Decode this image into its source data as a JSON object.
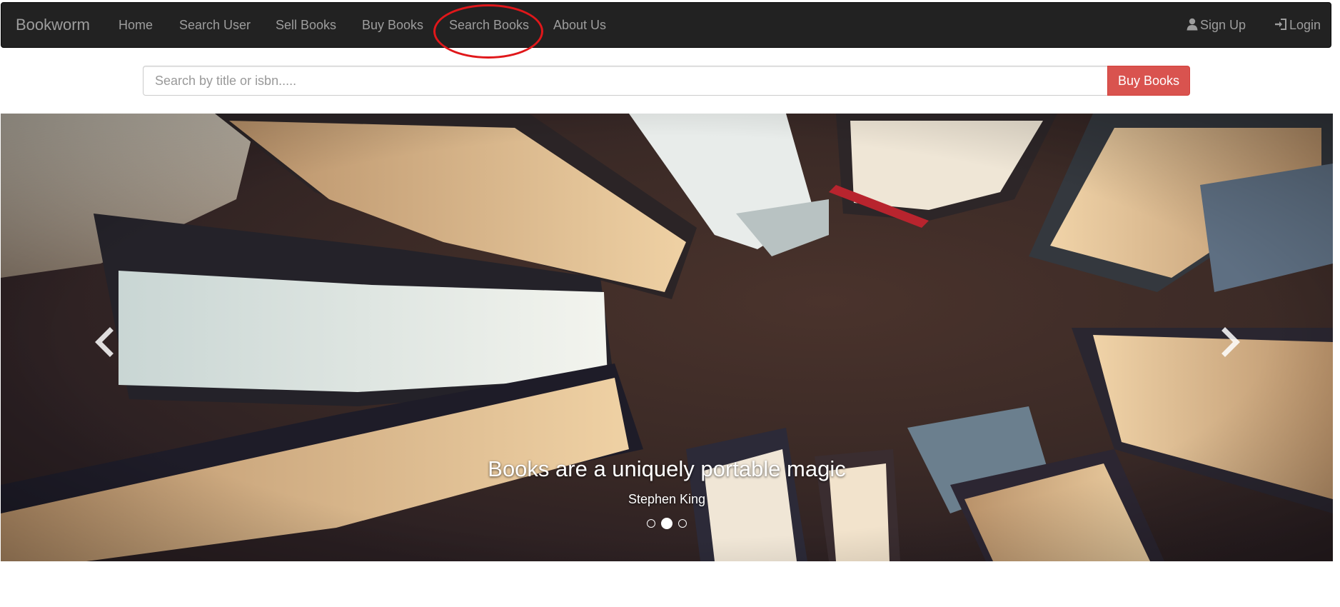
{
  "navbar": {
    "brand": "Bookworm",
    "links": [
      {
        "label": "Home"
      },
      {
        "label": "Search User"
      },
      {
        "label": "Sell Books"
      },
      {
        "label": "Buy Books"
      },
      {
        "label": "Search Books"
      },
      {
        "label": "About Us"
      }
    ],
    "right": {
      "signup": {
        "label": "Sign Up",
        "icon": "user-icon"
      },
      "login": {
        "label": "Login",
        "icon": "log-in-icon"
      }
    },
    "highlighted_link": "Search Books",
    "highlight_color": "#e0171a"
  },
  "search": {
    "placeholder": "Search by title or isbn.....",
    "value": "",
    "button_label": "Buy Books",
    "button_color": "#d9534f"
  },
  "carousel": {
    "caption_title": "Books are a uniquely portable magic",
    "caption_author": "Stephen King",
    "indicator_count": 3,
    "active_index": 1,
    "prev_icon": "chevron-left-icon",
    "next_icon": "chevron-right-icon"
  },
  "colors": {
    "navbar_bg": "#222222",
    "nav_text": "#9d9d9d"
  }
}
